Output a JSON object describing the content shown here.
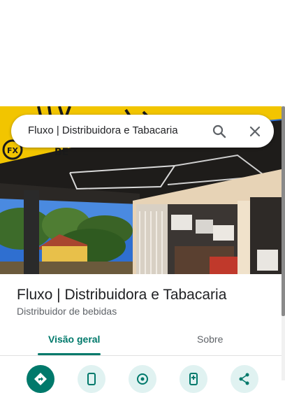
{
  "search": {
    "query": "Fluxo | Distribuidora e Tabacaria"
  },
  "place": {
    "name": "Fluxo | Distribuidora e Tabacaria",
    "category": "Distribuidor de bebidas"
  },
  "tabs": [
    {
      "label": "Visão geral",
      "active": true
    },
    {
      "label": "Sobre",
      "active": false
    }
  ],
  "actions": [
    {
      "icon": "directions-icon"
    },
    {
      "icon": "phone-icon"
    },
    {
      "icon": "navigation-icon"
    },
    {
      "icon": "save-icon"
    },
    {
      "icon": "share-icon"
    }
  ],
  "colors": {
    "accent": "#00796b",
    "action_bg": "#e0f2f1",
    "sign_yellow": "#f2c500"
  }
}
